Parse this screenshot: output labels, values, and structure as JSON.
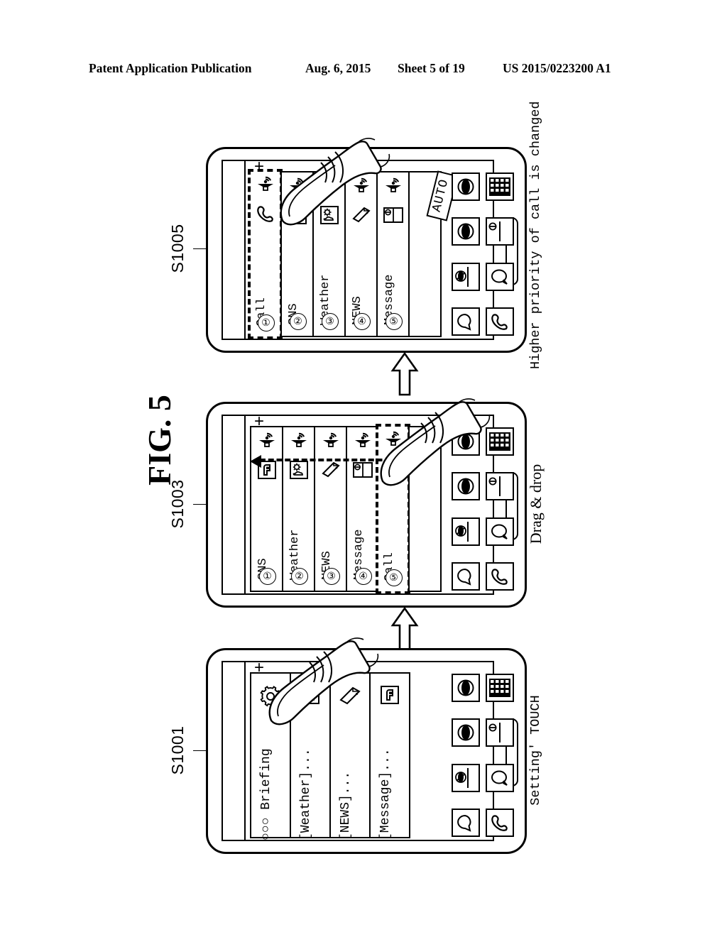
{
  "header": {
    "publication": "Patent Application Publication",
    "date": "Aug. 6, 2015",
    "sheet": "Sheet 5 of 19",
    "number": "US 2015/0223200 A1"
  },
  "figure": {
    "title": "FIG. 5"
  },
  "steps": [
    {
      "id": "S1005",
      "label": "S1005",
      "caption": "Higher priority of call is changed",
      "caption_font": "mono",
      "has_auto_badge": true,
      "auto_badge": "AUTO",
      "plus": "+",
      "cards": [
        {
          "num": "①",
          "label": "Call",
          "icon": "phone-icon",
          "speaker": true,
          "selected": true
        },
        {
          "num": "②",
          "label": "SNS",
          "icon": "facebook-icon",
          "speaker": true,
          "selected": false
        },
        {
          "num": "③",
          "label": "Weather",
          "icon": "weather-icon",
          "speaker": true,
          "selected": false
        },
        {
          "num": "④",
          "label": "NEWS",
          "icon": "news-icon",
          "speaker": true,
          "selected": false
        },
        {
          "num": "⑤",
          "label": "Message",
          "icon": "message-icon",
          "speaker": true,
          "selected": false
        }
      ]
    },
    {
      "id": "S1003",
      "label": "S1003",
      "caption": "Drag & drop",
      "caption_font": "serif",
      "has_auto_badge": false,
      "plus": "+",
      "cards": [
        {
          "num": "①",
          "label": "SNS",
          "icon": "facebook-icon",
          "speaker": true,
          "selected": false
        },
        {
          "num": "②",
          "label": "Weather",
          "icon": "weather-icon",
          "speaker": true,
          "selected": false
        },
        {
          "num": "③",
          "label": "NEWS",
          "icon": "news-icon",
          "speaker": true,
          "selected": false
        },
        {
          "num": "④",
          "label": "Message",
          "icon": "message-icon",
          "speaker": true,
          "selected": false
        },
        {
          "num": "⑤",
          "label": "Call",
          "icon": "phone-icon",
          "speaker": true,
          "selected": true
        }
      ]
    },
    {
      "id": "S1001",
      "label": "S1001",
      "caption": "Setting' TOUCH",
      "caption_font": "mono",
      "has_auto_badge": false,
      "plus": "+",
      "cards": [
        {
          "num": "",
          "label": "○○○ Briefing",
          "icon": "gear-icon",
          "speaker": false,
          "selected": false
        },
        {
          "num": "",
          "label": "[Weather]...",
          "icon": "weather-icon",
          "speaker": false,
          "selected": false
        },
        {
          "num": "",
          "label": "[NEWS]...",
          "icon": "news-icon",
          "speaker": false,
          "selected": false
        },
        {
          "num": "",
          "label": "[Message]...",
          "icon": "facebook-icon",
          "speaker": false,
          "selected": false
        }
      ]
    }
  ],
  "dock": {
    "column_right": [
      "app-grid-icon",
      "split-screen-icon",
      "speech-bubble-icon",
      "phone-handset-icon"
    ],
    "column_left": [
      "browser-icon",
      "browser-icon",
      "browser-split-icon",
      "bubble-icon"
    ]
  },
  "annotations": {
    "drag_arrow_direction": "left",
    "transition_arrow": "up"
  },
  "colors": {
    "ink": "#000000",
    "paper": "#ffffff"
  }
}
